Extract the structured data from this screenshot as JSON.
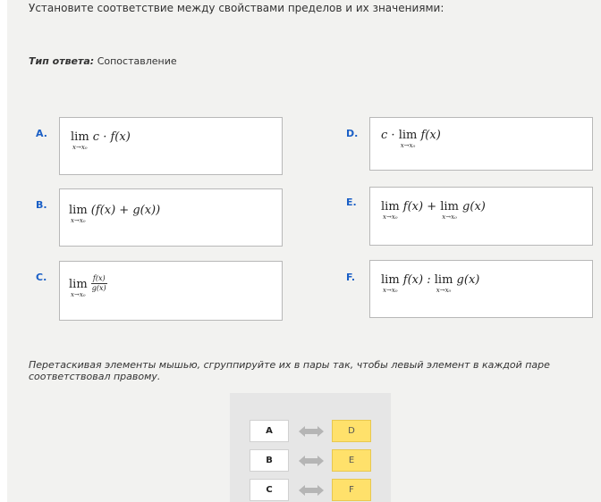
{
  "question": "Установите соответствие между свойствами пределов и их значениями:",
  "answer_type": {
    "label": "Тип ответа:",
    "value": "Сопоставление"
  },
  "items": {
    "A": {
      "letter": "A.",
      "lim": "lim",
      "sub": "x→x₀",
      "expr": "c · f(x)"
    },
    "B": {
      "letter": "B.",
      "lim": "lim",
      "sub": "x→x₀",
      "expr": "(f(x) + g(x))"
    },
    "C": {
      "letter": "C.",
      "lim": "lim",
      "sub": "x→x₀",
      "num": "f(x)",
      "den": "g(x)"
    },
    "D": {
      "letter": "D.",
      "pre": "c ·",
      "lim": "lim",
      "sub": "x→x₀",
      "expr": "f(x)"
    },
    "E": {
      "letter": "E.",
      "lim1": "lim",
      "sub1": "x→x₀",
      "expr1": "f(x) +",
      "lim2": "lim",
      "sub2": "x→x₀",
      "expr2": "g(x)"
    },
    "F": {
      "letter": "F.",
      "lim1": "lim",
      "sub1": "x→x₀",
      "expr1": "f(x) :",
      "lim2": "lim",
      "sub2": "x→x₀",
      "expr2": "g(x)"
    }
  },
  "instruction": "Перетаскивая элементы мышью, сгруппируйте их в пары так, чтобы левый элемент в каждой паре соответствовал правому.",
  "pairs": [
    {
      "left": "A",
      "right": "D"
    },
    {
      "left": "B",
      "right": "E"
    },
    {
      "left": "C",
      "right": "F"
    }
  ],
  "colors": {
    "letter": "#1a5fc6",
    "answer_chip": "#ffe16b",
    "panel_bg": "#f2f2f0",
    "match_bg": "#e6e6e6"
  },
  "icons": {
    "pair_arrow": "double-arrow-icon"
  }
}
